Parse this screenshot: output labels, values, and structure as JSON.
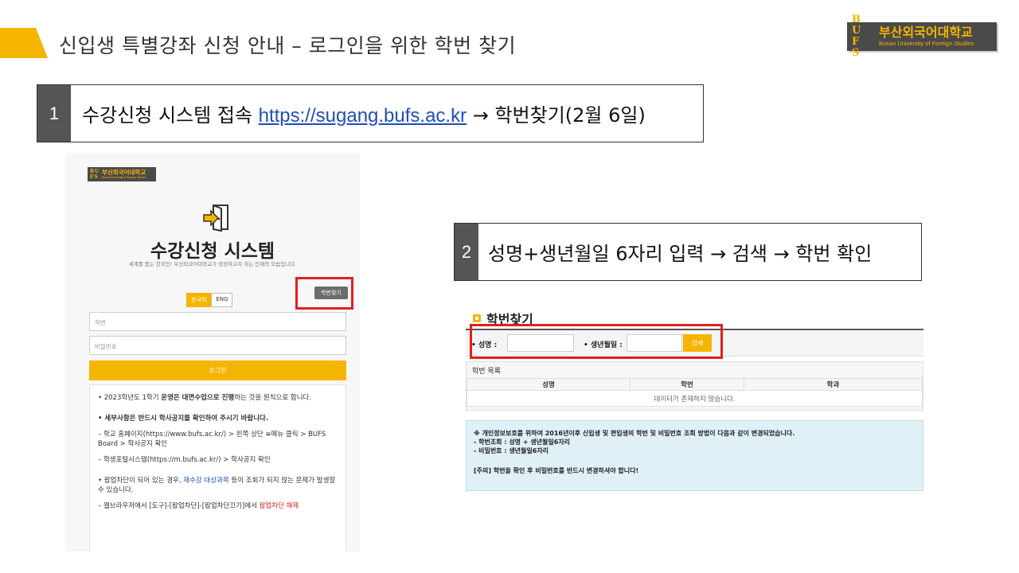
{
  "header": {
    "title": "신입생 특별강좌 신청 안내 – 로그인을 위한 학번 찾기"
  },
  "logo": {
    "mark_line1": "B U",
    "mark_line2": "F S",
    "name_kr": "부산외국어대학교",
    "name_en": "Busan University of Foreign Studies"
  },
  "step1": {
    "number": "1",
    "text_before": "수강신청 시스템 접속 ",
    "link": "https://sugang.bufs.ac.kr",
    "text_after": " → 학번찾기(2월 6일)"
  },
  "step2": {
    "number": "2",
    "text": "성명+생년월일 6자리 입력 → 검색 → 학번 확인"
  },
  "login_screen": {
    "logo_name": "부산외국어대학교",
    "logo_en": "Busan University of Foreign Studies",
    "title": "수강신청 시스템",
    "subtitle": "세계를 품는 한국인! 부산외국어대학교가 양성하고자 하는 인재의 모습입니다.",
    "find_button": "학번찾기",
    "lang_ko": "한국어",
    "lang_en": "ENG",
    "id_placeholder": "학번",
    "pw_placeholder": "비밀번호",
    "login_button": "로그인",
    "notice": {
      "p1_pre": "• 2023학년도 1학기 ",
      "p1_bold": "운영은 대면수업으로 진행",
      "p1_post": "하는 것을 원칙으로 합니다.",
      "p2": "• 세부사항은 반드시 학사공지를 확인하여 주시기 바랍니다.",
      "p3": "– 학교 홈페이지(https://www.bufs.ac.kr/) > 왼쪽 상단 ≡메뉴 클릭 > BUFS Board > 학사공지 확인",
      "p4": "– 학생포털시스템(https://m.bufs.ac.kr/) > 학사공지 확인",
      "p5_pre": "• 팝업차단이 되어 있는 경우, ",
      "p5_blue": "재수강 대상과목",
      "p5_post": " 등이 조회가 되지 않는 문제가 발생할 수 있습니다.",
      "p6_pre": "– 웹브라우저에서 [도구]-[팝업차단]-[팝업차단끄기]에서 ",
      "p6_red": "팝업차단 해제"
    }
  },
  "find_screen": {
    "heading": "학번찾기",
    "name_label": "• 성명 :",
    "birth_label": "• 생년월일 :",
    "search_button": "검색",
    "list_title": "학번 목록",
    "columns": [
      "성명",
      "학번",
      "학과"
    ],
    "empty_message": "데이터가 존재하지 않습니다.",
    "info": {
      "line1": "※ 개인정보보호를 위하여 2016년이후 신입생 및 편입생의 학번 및 비밀번호 조회 방법이 다음과 같이 변경되었습니다.",
      "line2": "- 학번조회 : 성명 + 생년월일6자리",
      "line3": "- 비밀번호 : 생년월일6자리",
      "line4": "[주의] 학번을 확인 후 비밀번호를 반드시 변경하셔야 합니다!"
    }
  },
  "colors": {
    "accent": "#f5b400",
    "highlight": "#e02020",
    "link": "#1f4fb5"
  }
}
